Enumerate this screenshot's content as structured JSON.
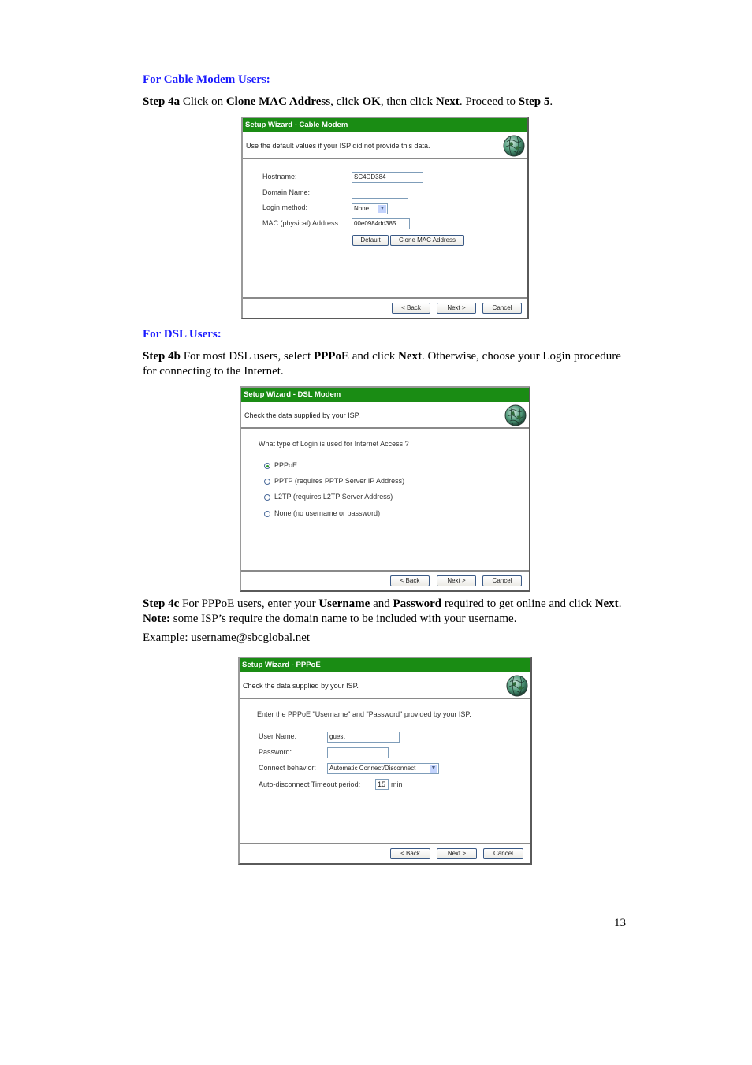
{
  "sections": {
    "cable_heading": "For Cable Modem Users:",
    "step4a": {
      "step": "Step 4a",
      "t1": " Click on ",
      "b1": "Clone MAC Address",
      "t2": ", click ",
      "b2": "OK",
      "t3": ", then click ",
      "b3": "Next",
      "t4": ". Proceed to ",
      "b4": "Step 5",
      "t5": "."
    },
    "dsl_heading": "For DSL Users:",
    "step4b": {
      "step": "Step 4b",
      "t1": " For most DSL users, select ",
      "b1": "PPPoE",
      "t2": " and click ",
      "b2": "Next",
      "t3": ". Otherwise, choose your Login procedure for connecting to the Internet."
    },
    "step4c": {
      "step": "Step 4c",
      "t1": " For PPPoE users, enter your ",
      "b1": "Username",
      "t2": " and ",
      "b2": "Password",
      "t3": " required to get online and click ",
      "b3": "Next",
      "t4": ". ",
      "b4": "Note:",
      "t5": " some ISP’s require the domain name to be included with your username."
    },
    "example": "Example: username@sbcglobal.net"
  },
  "cable_wizard": {
    "title": "Setup Wizard - Cable Modem",
    "subtitle": "Use the default values if your ISP did not provide this data.",
    "hostname_label": "Hostname:",
    "hostname_value": "SC4DD384",
    "domain_label": "Domain Name:",
    "domain_value": "",
    "login_label": "Login method:",
    "login_value": "None",
    "mac_label": "MAC (physical) Address:",
    "mac_value": "00e0984dd385",
    "default_btn": "Default",
    "clone_btn": "Clone MAC Address",
    "back_btn": "< Back",
    "next_btn": "Next >",
    "cancel_btn": "Cancel"
  },
  "dsl_wizard": {
    "title": "Setup Wizard - DSL Modem",
    "subtitle": "Check the data supplied by your ISP.",
    "question": "What type of Login is used for Internet Access ?",
    "options": [
      {
        "label": "PPPoE",
        "selected": true
      },
      {
        "label": "PPTP (requires PPTP Server IP Address)",
        "selected": false
      },
      {
        "label": "L2TP (requires L2TP Server Address)",
        "selected": false
      },
      {
        "label": "None (no username or password)",
        "selected": false
      }
    ],
    "back_btn": "< Back",
    "next_btn": "Next >",
    "cancel_btn": "Cancel"
  },
  "pppoe_wizard": {
    "title": "Setup Wizard - PPPoE",
    "subtitle": "Check the data supplied by your ISP.",
    "instruction": "Enter the PPPoE \"Username\" and \"Password\" provided by your ISP.",
    "username_label": "User Name:",
    "username_value": "guest",
    "password_label": "Password:",
    "password_value": "",
    "behavior_label": "Connect behavior:",
    "behavior_value": "Automatic Connect/Disconnect",
    "timeout_label": "Auto-disconnect Timeout period:",
    "timeout_value": "15",
    "timeout_unit": "min",
    "back_btn": "< Back",
    "next_btn": "Next >",
    "cancel_btn": "Cancel"
  },
  "page_number": "13"
}
